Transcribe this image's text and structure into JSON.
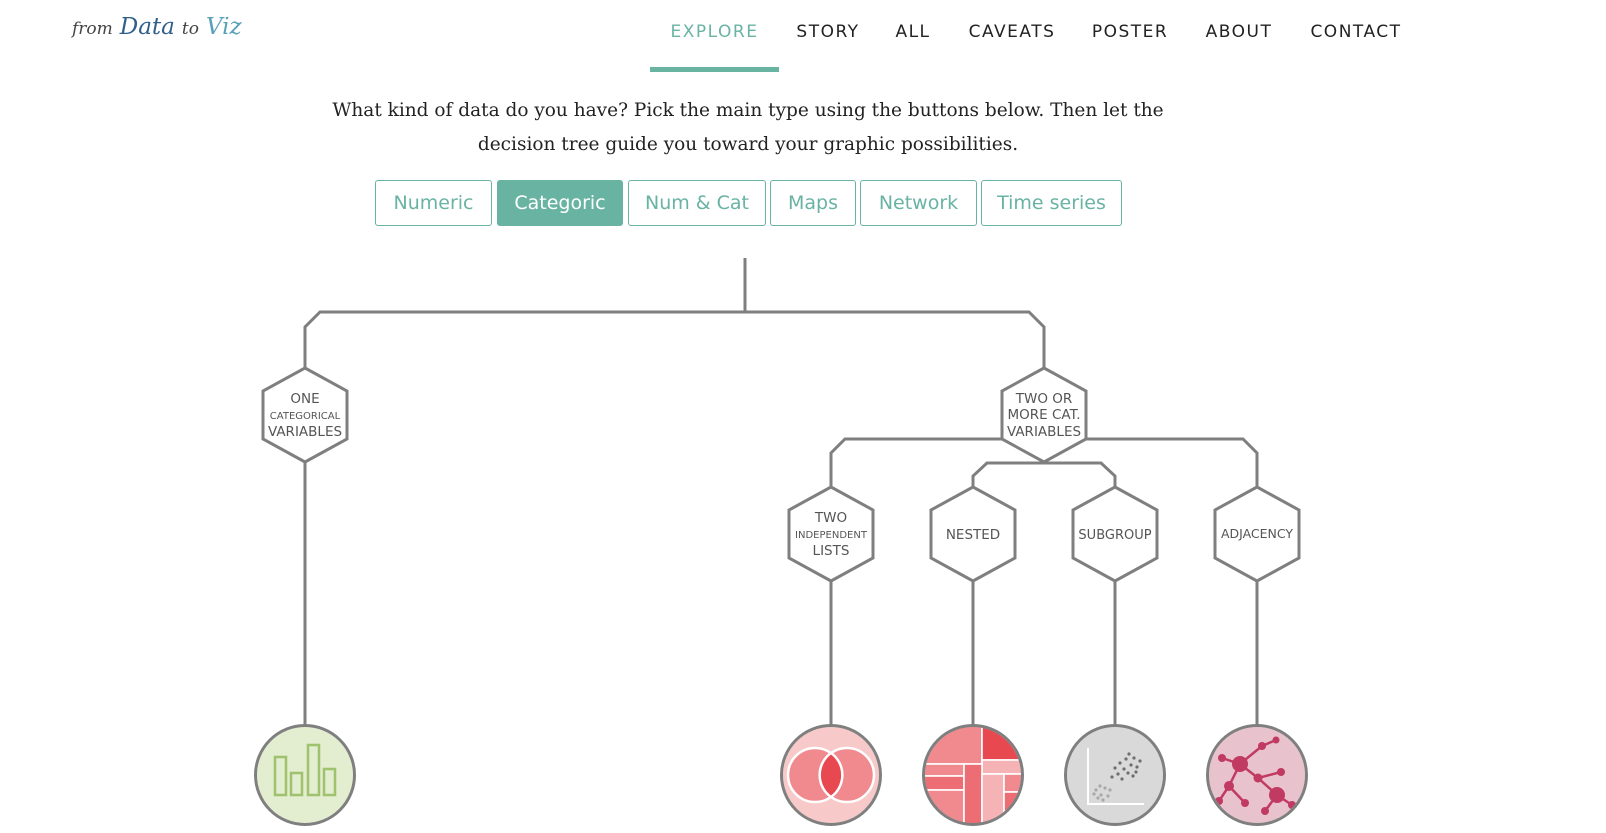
{
  "logo": {
    "from": "from",
    "data": "Data",
    "to": "to",
    "viz": "Viz"
  },
  "nav": [
    {
      "label": "EXPLORE",
      "active": true
    },
    {
      "label": "STORY",
      "active": false
    },
    {
      "label": "ALL",
      "active": false
    },
    {
      "label": "CAVEATS",
      "active": false
    },
    {
      "label": "POSTER",
      "active": false
    },
    {
      "label": "ABOUT",
      "active": false
    },
    {
      "label": "CONTACT",
      "active": false
    }
  ],
  "intro": {
    "line1": "What kind of data do you have? Pick the main type using the buttons below. Then let the",
    "line2": "decision tree guide you toward your graphic possibilities."
  },
  "tabs": [
    {
      "label": "Numeric",
      "active": false
    },
    {
      "label": "Categoric",
      "active": true
    },
    {
      "label": "Num & Cat",
      "active": false
    },
    {
      "label": "Maps",
      "active": false
    },
    {
      "label": "Network",
      "active": false
    },
    {
      "label": "Time series",
      "active": false
    }
  ],
  "tree": {
    "one_cat": {
      "line1": "ONE",
      "line2": "CATEGORICAL",
      "line3": "VARIABLES"
    },
    "two_cat": {
      "line1": "TWO OR",
      "line2": "MORE CAT.",
      "line3": "VARIABLES"
    },
    "two_lists": {
      "line1": "TWO",
      "line2": "INDEPENDENT",
      "line3": "LISTS"
    },
    "nested": {
      "label": "NESTED"
    },
    "subgroup": {
      "label": "SUBGROUP"
    },
    "adjacency": {
      "label": "ADJACENCY"
    }
  },
  "colors": {
    "accent": "#69b3a2",
    "tree_line": "#7f7f7f",
    "barplot_bg": "#e3edcf",
    "barplot_fg": "#9fc26f",
    "venn_bg": "#f7c9c9",
    "venn_fg": "#e8484f",
    "treemap_fg": "#e8484f",
    "scatter_bg": "#d9d9d9",
    "network_bg": "#e8c2cc",
    "network_fg": "#c03a62"
  }
}
